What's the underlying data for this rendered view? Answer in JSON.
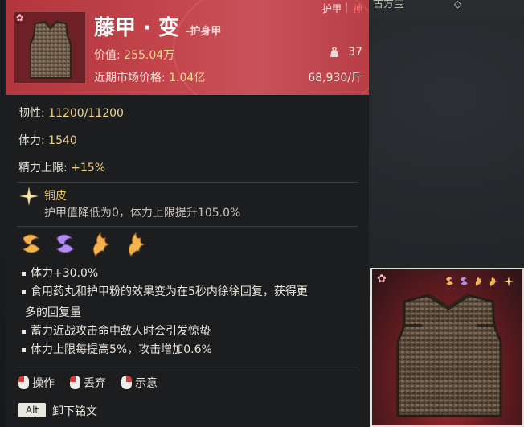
{
  "background": {
    "top_text": "古方宝",
    "top_icon": "diamond-icon"
  },
  "header": {
    "tag_armor": "护甲",
    "tag_sep": "|",
    "tag_god": "神",
    "title": "藤甲 · 变",
    "subtitle": "-护身甲",
    "value_label": "价值:",
    "value": "255.04万",
    "weight": "37",
    "market_label": "近期市场价格:",
    "market_price": "1.04亿",
    "market_unit_price": "68,930/斤"
  },
  "stats": {
    "toughness_label": "韧性:",
    "toughness": "11200/11200",
    "stamina_label": "体力:",
    "stamina": "1540",
    "energy_label": "精力上限:",
    "energy": "+15%"
  },
  "perk": {
    "name": "铜皮",
    "desc": "护甲值降低为0，体力上限提升105.0%"
  },
  "bullets": [
    "体力+30.0%",
    "食用药丸和护甲粉的效果变为在5秒内徐徐回复，获得更",
    "多的回复量",
    "蓄力近战攻击命中敌人时会引发惊蛰",
    "体力上限每提高5%，攻击增加0.6%"
  ],
  "actions": {
    "operate": "操作",
    "discard": "丢弃",
    "show": "示意"
  },
  "alt": {
    "key": "Alt",
    "label": "卸下铭文"
  },
  "colors": {
    "header_red": "#c4454c",
    "gold": "#f1c45a",
    "value_yellow": "#ffd999",
    "god_red": "#ff6b6b",
    "glyph_orange": "#f2b451",
    "glyph_purple": "#b58cf0"
  }
}
